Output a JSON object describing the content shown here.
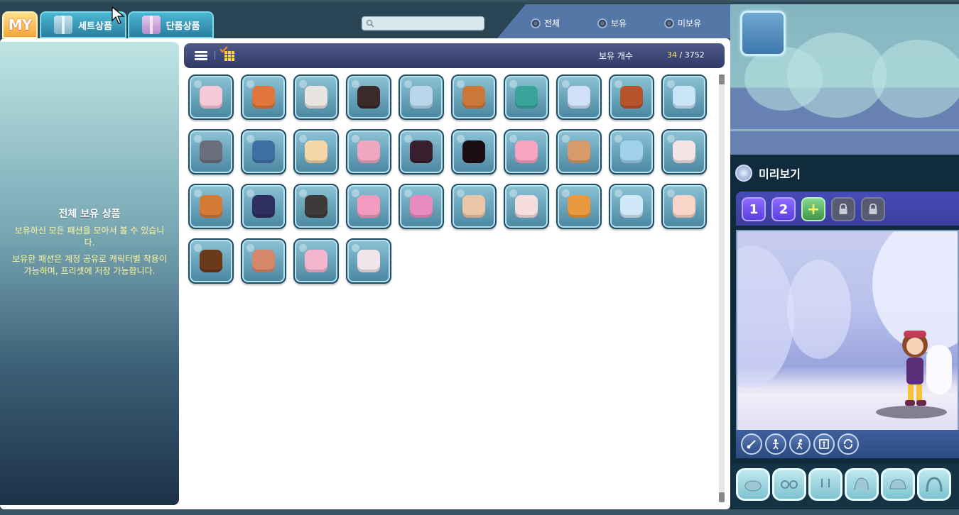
{
  "tabs": {
    "my_label": "MY",
    "set_label": "세트상품",
    "single_label": "단품상품"
  },
  "search": {
    "value": "",
    "placeholder": ""
  },
  "filters": [
    {
      "label": "전체",
      "selected": false
    },
    {
      "label": "보유",
      "selected": false
    },
    {
      "label": "미보유",
      "selected": false
    }
  ],
  "left_panel": {
    "title": "전체 보유 상품",
    "desc1": "보유하신 모든 패션을 모아서 볼 수 있습니다.",
    "desc2": "보유한 패션은 계정 공유로 캐릭터별 착용이 가능하며, 프리셋에 저장 가능합니다."
  },
  "header": {
    "count_label": "보유 개수",
    "owned": "34",
    "separator": "/",
    "total": "3752"
  },
  "items": [
    {
      "name": "pink-cat-hat",
      "color": "#f5c9d6"
    },
    {
      "name": "flame-armor",
      "color": "#e0763a"
    },
    {
      "name": "white-puppy",
      "color": "#e8e4e0"
    },
    {
      "name": "cow-hoodie",
      "color": "#3b2a2a"
    },
    {
      "name": "blue-robe",
      "color": "#b9d6ea"
    },
    {
      "name": "tiger-cape",
      "color": "#c9783a"
    },
    {
      "name": "teal-shoes",
      "color": "#3aa39a"
    },
    {
      "name": "ribbon-fork",
      "color": "#cfe0f7"
    },
    {
      "name": "orange-tail",
      "color": "#b8542c"
    },
    {
      "name": "blue-bear",
      "color": "#c9e4f5"
    },
    {
      "name": "penguin",
      "color": "#6b6e7e"
    },
    {
      "name": "tornado",
      "color": "#3f6fa3"
    },
    {
      "name": "cream-dress",
      "color": "#f6d7a8"
    },
    {
      "name": "pink-ballet-dress",
      "color": "#f1a6bf"
    },
    {
      "name": "cherry-heels",
      "color": "#3a1f2f"
    },
    {
      "name": "black-gothic-dress",
      "color": "#1c0f14"
    },
    {
      "name": "pink-frill-dress",
      "color": "#f7a3c2"
    },
    {
      "name": "hamster-pair",
      "color": "#d89a6a"
    },
    {
      "name": "blue-puppies",
      "color": "#9fd0ec"
    },
    {
      "name": "sheep-slippers",
      "color": "#f4e5e5"
    },
    {
      "name": "orange-sneakers",
      "color": "#d47a33"
    },
    {
      "name": "navy-boots",
      "color": "#2f2f5f"
    },
    {
      "name": "black-white-boots",
      "color": "#3e3a3a"
    },
    {
      "name": "pink-boots",
      "color": "#f29ac0"
    },
    {
      "name": "pink-fur-pouch",
      "color": "#e68cc0"
    },
    {
      "name": "hamster",
      "color": "#e9c7a6"
    },
    {
      "name": "cherub-wings",
      "color": "#f7dede"
    },
    {
      "name": "orange-cheeks",
      "color": "#e7993d"
    },
    {
      "name": "blue-polar-bear",
      "color": "#cfe8f7"
    },
    {
      "name": "peach-sheep",
      "color": "#f8d5c8"
    },
    {
      "name": "golden-horns",
      "color": "#6a3a1a"
    },
    {
      "name": "peach-ribbon",
      "color": "#d5876a"
    },
    {
      "name": "cake-crown",
      "color": "#f3b6cc"
    },
    {
      "name": "kitsune-mask",
      "color": "#f3e6ea"
    }
  ],
  "preview": {
    "title": "미리보기",
    "presets": [
      "1",
      "2",
      "+"
    ]
  },
  "action_buttons": [
    {
      "name": "brush-icon"
    },
    {
      "name": "stand-icon"
    },
    {
      "name": "walk-icon"
    },
    {
      "name": "frame-icon"
    },
    {
      "name": "rotate-icon"
    }
  ],
  "equip_slots": [
    {
      "name": "hat-slot-icon"
    },
    {
      "name": "glasses-slot-icon"
    },
    {
      "name": "earring-slot-icon"
    },
    {
      "name": "hair-slot-icon"
    },
    {
      "name": "cap-slot-icon"
    },
    {
      "name": "hood-slot-icon"
    },
    {
      "name": "cape-slot-icon"
    }
  ],
  "colors": {
    "accent_purple": "#464bb7",
    "slot_blue": "#4a86a0",
    "owned_count": "#ffe36b",
    "info_text": "#fff5a0"
  }
}
